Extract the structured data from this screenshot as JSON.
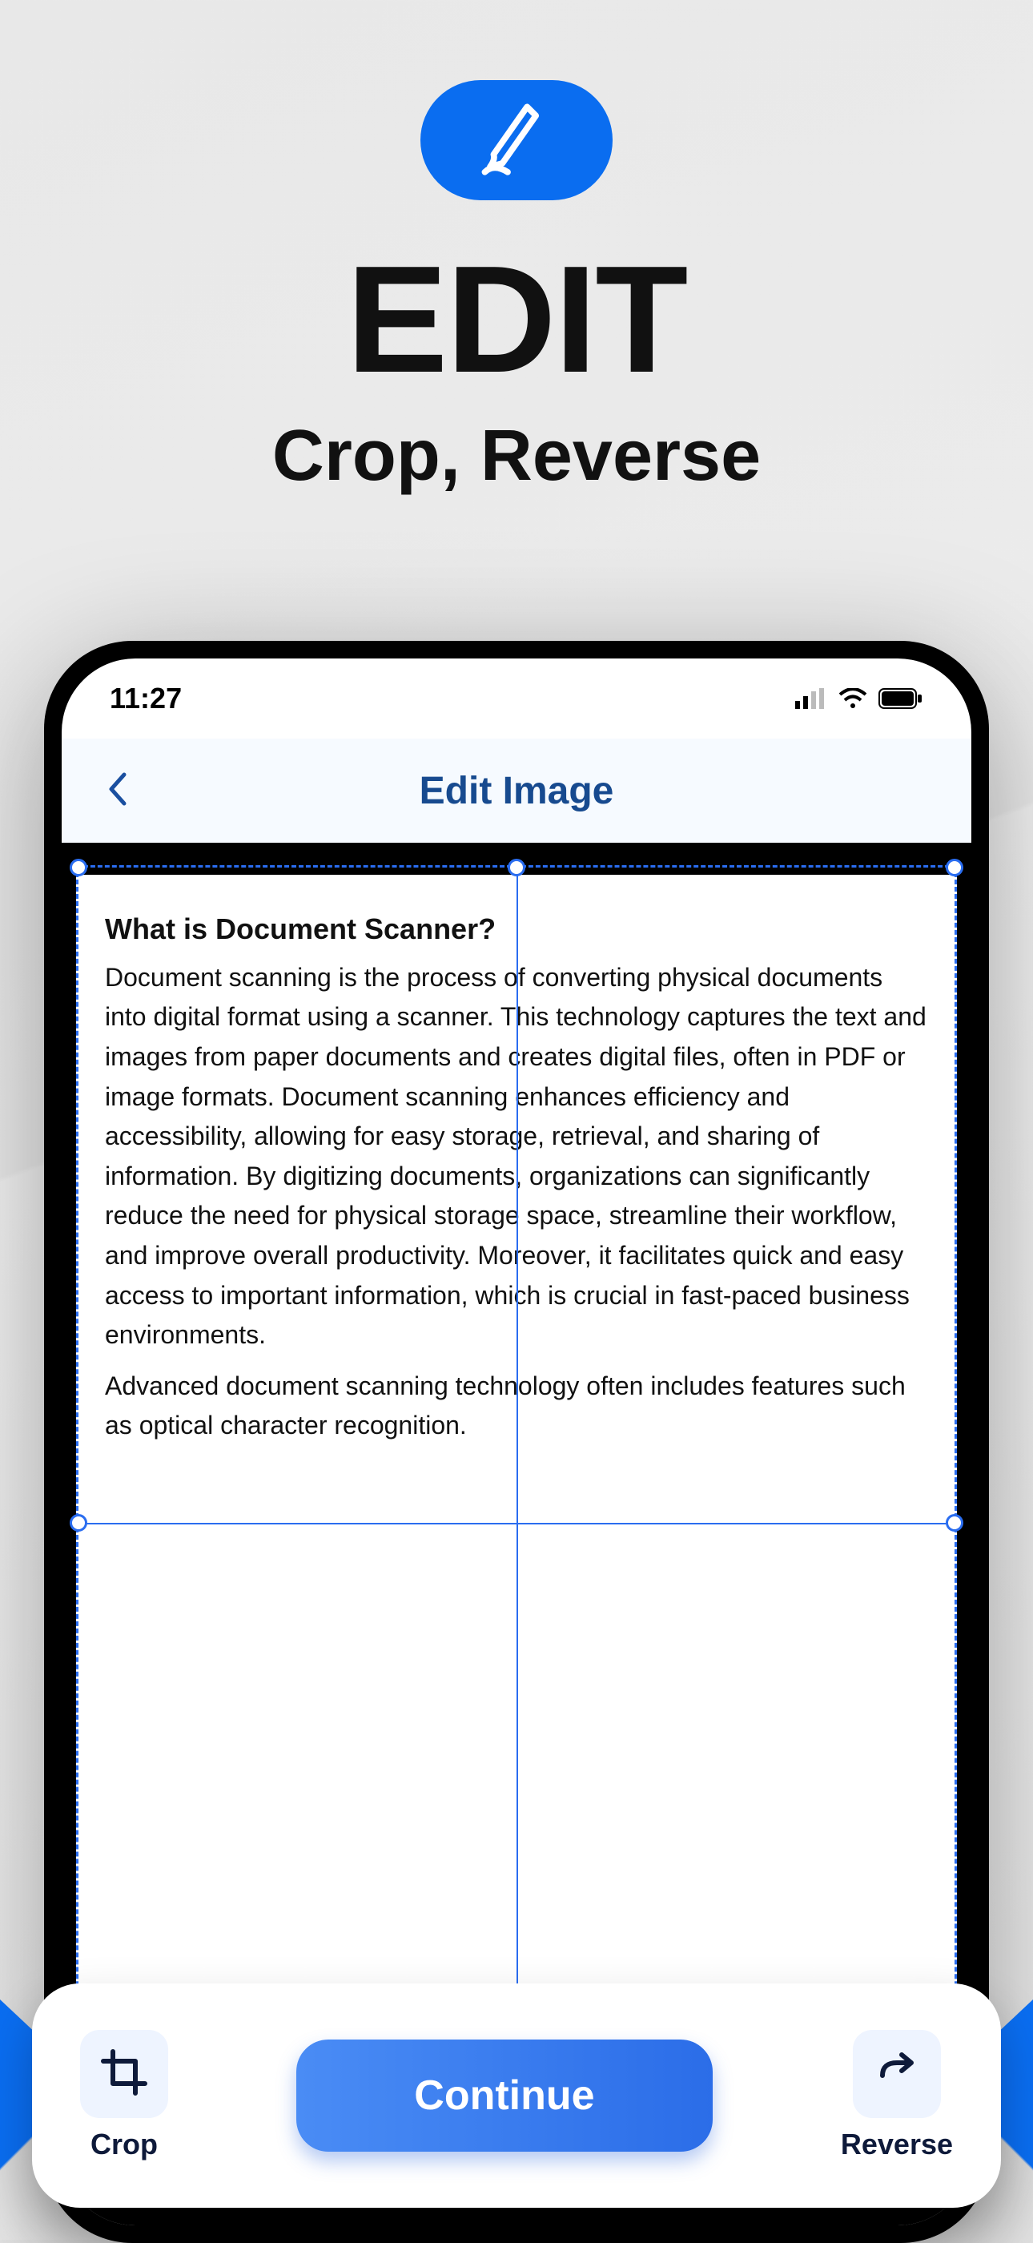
{
  "hero": {
    "title": "EDIT",
    "subtitle": "Crop, Reverse"
  },
  "status": {
    "time": "11:27"
  },
  "app": {
    "screen_title": "Edit Image"
  },
  "document": {
    "heading": "What is Document Scanner?",
    "body1": "Document scanning is the process of converting physical documents into digital format using a scanner. This technology captures the text and images from paper documents and creates digital files, often in PDF or image formats. Document scanning enhances efficiency and accessibility, allowing for easy storage, retrieval, and sharing of information. By digitizing documents, organizations can significantly reduce the need for physical storage space, streamline their workflow, and improve overall productivity. Moreover, it facilitates quick and easy access to important information, which is crucial in fast-paced business environments.",
    "body2": "Advanced document scanning technology often includes features such as optical character recognition."
  },
  "toolbar": {
    "crop_label": "Crop",
    "continue_label": "Continue",
    "reverse_label": "Reverse"
  },
  "colors": {
    "accent": "#0a6df0"
  }
}
